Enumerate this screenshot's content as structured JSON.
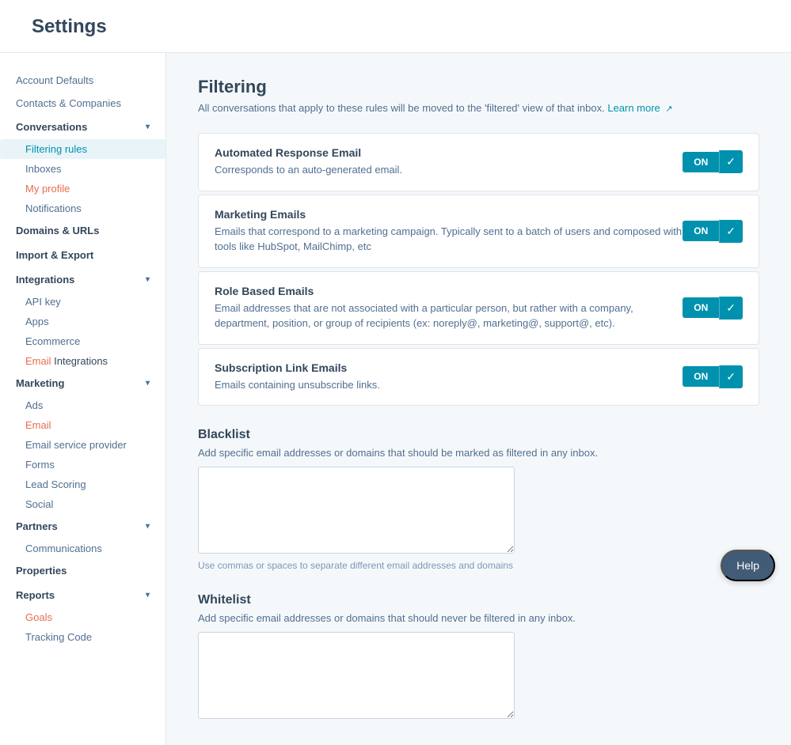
{
  "header": {
    "title": "Settings"
  },
  "sidebar": {
    "top_items": [
      {
        "id": "account-defaults",
        "label": "Account Defaults"
      },
      {
        "id": "contacts-companies",
        "label": "Contacts & Companies"
      }
    ],
    "sections": [
      {
        "id": "conversations",
        "label": "Conversations",
        "expanded": true,
        "items": [
          {
            "id": "filtering-rules",
            "label": "Filtering rules",
            "active": true
          },
          {
            "id": "inboxes",
            "label": "Inboxes"
          },
          {
            "id": "my-profile",
            "label": "My profile",
            "highlight": true
          },
          {
            "id": "notifications",
            "label": "Notifications"
          }
        ]
      },
      {
        "id": "domains-urls",
        "label": "Domains & URLs",
        "expanded": false,
        "items": []
      },
      {
        "id": "import-export",
        "label": "Import & Export",
        "expanded": false,
        "items": []
      },
      {
        "id": "integrations",
        "label": "Integrations",
        "expanded": true,
        "items": [
          {
            "id": "api-key",
            "label": "API key"
          },
          {
            "id": "apps",
            "label": "Apps"
          },
          {
            "id": "ecommerce",
            "label": "Ecommerce"
          },
          {
            "id": "email-integrations",
            "label": "Email Integrations",
            "partial_highlight": true
          }
        ]
      },
      {
        "id": "marketing",
        "label": "Marketing",
        "expanded": true,
        "items": [
          {
            "id": "ads",
            "label": "Ads"
          },
          {
            "id": "email",
            "label": "Email",
            "highlight": true
          },
          {
            "id": "email-service-provider",
            "label": "Email service provider"
          },
          {
            "id": "forms",
            "label": "Forms"
          },
          {
            "id": "lead-scoring",
            "label": "Lead Scoring"
          },
          {
            "id": "social",
            "label": "Social"
          }
        ]
      },
      {
        "id": "partners",
        "label": "Partners",
        "expanded": true,
        "items": [
          {
            "id": "communications",
            "label": "Communications"
          }
        ]
      },
      {
        "id": "properties",
        "label": "Properties",
        "expanded": false,
        "items": []
      },
      {
        "id": "reports",
        "label": "Reports",
        "expanded": true,
        "items": [
          {
            "id": "goals",
            "label": "Goals",
            "highlight": true
          },
          {
            "id": "tracking-code",
            "label": "Tracking Code"
          }
        ]
      }
    ]
  },
  "main": {
    "title": "Filtering",
    "subtitle": "All conversations that apply to these rules will be moved to the 'filtered' view of that inbox.",
    "learn_more_label": "Learn more",
    "filter_cards": [
      {
        "id": "automated-response-email",
        "title": "Automated Response Email",
        "description": "Corresponds to an auto-generated email.",
        "toggle": "ON"
      },
      {
        "id": "marketing-emails",
        "title": "Marketing Emails",
        "description": "Emails that correspond to a marketing campaign. Typically sent to a batch of users and composed with tools like HubSpot, MailChimp, etc",
        "toggle": "ON"
      },
      {
        "id": "role-based-emails",
        "title": "Role Based Emails",
        "description": "Email addresses that are not associated with a particular person, but rather with a company, department, position, or group of recipients (ex: noreply@, marketing@, support@, etc).",
        "toggle": "ON"
      },
      {
        "id": "subscription-link-emails",
        "title": "Subscription Link Emails",
        "description": "Emails containing unsubscribe links.",
        "toggle": "ON"
      }
    ],
    "blacklist": {
      "title": "Blacklist",
      "description": "Add specific email addresses or domains that should be marked as filtered in any inbox.",
      "value": "",
      "helper": "Use commas or spaces to separate different email addresses and domains"
    },
    "whitelist": {
      "title": "Whitelist",
      "description": "Add specific email addresses or domains that should never be filtered in any inbox.",
      "value": "",
      "helper": ""
    }
  },
  "help_button": "Help"
}
